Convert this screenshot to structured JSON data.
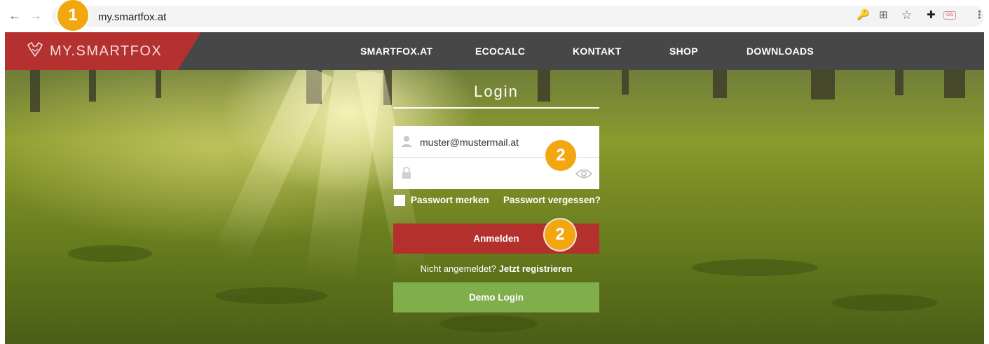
{
  "browser": {
    "url": "my.smartfox.at",
    "back_icon": "←",
    "forward_icon": "→",
    "key_icon": "🔑",
    "translate_icon": "⊞",
    "star_icon": "☆",
    "extensions_icon": "✚",
    "menu_icon": "⋮",
    "dalle_badge": "DA"
  },
  "annotations": {
    "marker_1": "1",
    "marker_2a": "2",
    "marker_2b": "2"
  },
  "header": {
    "logo_text": "MY.SMARTFOX",
    "brand_color": "#b5312f",
    "menu": [
      "SMARTFOX.AT",
      "ECOCALC",
      "KONTAKT",
      "SHOP",
      "DOWNLOADS"
    ]
  },
  "login": {
    "title": "Login",
    "email_value": "muster@mustermail.at",
    "password_value": "",
    "remember_label": "Passwort merken",
    "forgot_label": "Passwort vergessen?",
    "submit_label": "Anmelden",
    "register_prefix": "Nicht angemeldet?",
    "register_link": "Jetzt registrieren",
    "demo_label": "Demo Login",
    "submit_color": "#b3302c",
    "demo_color": "#7fae4a"
  }
}
